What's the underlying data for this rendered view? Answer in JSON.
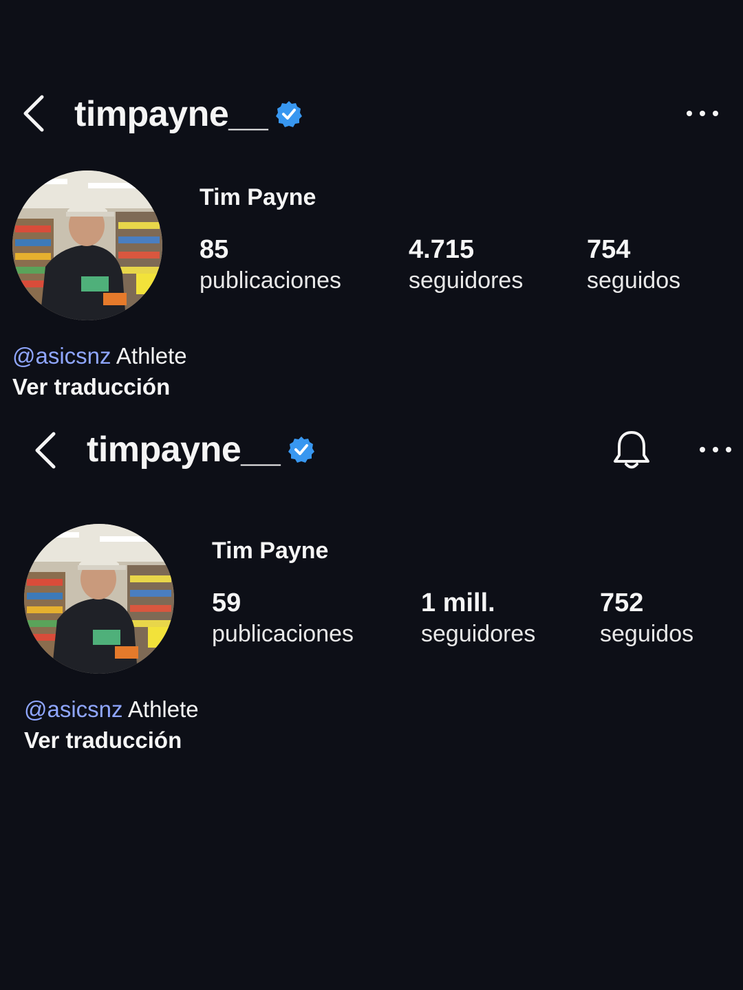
{
  "screenshots": [
    {
      "username": "timpayne__",
      "full_name": "Tim Payne",
      "posts": "85",
      "posts_label": "publicaciones",
      "followers": "4.715",
      "followers_label": "seguidores",
      "following": "754",
      "following_label": "seguidos",
      "bio_mention": "@asicsnz",
      "bio_text": " Athlete",
      "translate_label": "Ver traducción",
      "icons": [
        "back-arrow-icon",
        "verified-badge-icon",
        "more-options-icon"
      ]
    },
    {
      "username": "timpayne__",
      "full_name": "Tim Payne",
      "posts": "59",
      "posts_label": "publicaciones",
      "followers": "1 mill.",
      "followers_label": "seguidores",
      "following": "752",
      "following_label": "seguidos",
      "bio_mention": "@asicsnz",
      "bio_text": " Athlete",
      "translate_label": "Ver traducción",
      "icons": [
        "back-arrow-icon",
        "verified-badge-icon",
        "bell-icon",
        "more-options-icon"
      ]
    }
  ],
  "colors": {
    "background": "#0d0f17",
    "verified": "#3897f0",
    "mention": "#8fa6ff"
  }
}
